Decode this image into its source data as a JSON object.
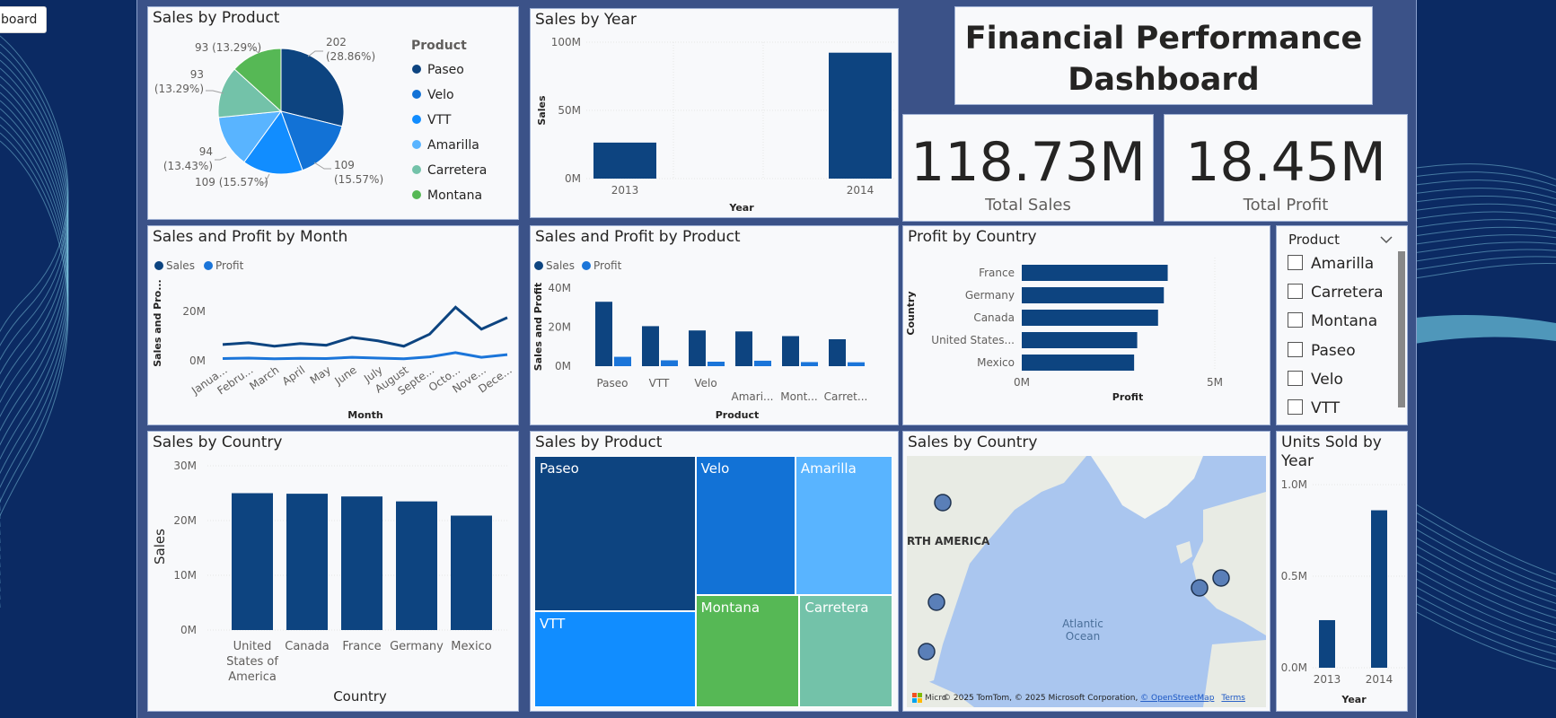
{
  "nav": {
    "back_label": "board"
  },
  "dashboard": {
    "title_line1": "Financial Performance",
    "title_line2": "Dashboard"
  },
  "kpis": {
    "total_sales": {
      "value": "118.73M",
      "label": "Total  Sales"
    },
    "total_profit": {
      "value": "18.45M",
      "label": "Total Profit"
    }
  },
  "colors": {
    "paseo": "#0d4480",
    "velo": "#1272d6",
    "vtt": "#118dff",
    "amarilla": "#59b4ff",
    "carretera": "#73c2a9",
    "montana": "#56b855",
    "bar": "#0d4480",
    "profit": "#1b75d9"
  },
  "slicer": {
    "title": "Product",
    "items": [
      "Amarilla",
      "Carretera",
      "Montana",
      "Paseo",
      "Velo",
      "VTT"
    ]
  },
  "chart_data": [
    {
      "id": "sales_by_product_pie",
      "type": "pie",
      "title": "Sales by Product",
      "legend_title": "Product",
      "legend_position": "right",
      "slices": [
        {
          "name": "Paseo",
          "value": 202,
          "pct": "28.86%"
        },
        {
          "name": "Velo",
          "value": 109,
          "pct": "15.57%"
        },
        {
          "name": "VTT",
          "value": 109,
          "pct": "15.57%"
        },
        {
          "name": "Amarilla",
          "value": 94,
          "pct": "13.43%"
        },
        {
          "name": "Carretera",
          "value": 93,
          "pct": "13.29%"
        },
        {
          "name": "Montana",
          "value": 93,
          "pct": "13.29%"
        }
      ],
      "data_labels": {
        "paseo": [
          "202",
          "(28.86%)"
        ],
        "velo": [
          "109",
          "(15.57%)"
        ],
        "vtt": "109 (15.57%)",
        "amarilla": [
          "94",
          "(13.43%)"
        ],
        "carretera": [
          "93",
          "(13.29%)"
        ],
        "montana": "93 (13.29%)"
      }
    },
    {
      "id": "sales_by_year",
      "type": "bar",
      "title": "Sales by Year",
      "categories": [
        "2013",
        "2014"
      ],
      "values": [
        26.4,
        92.3
      ],
      "xlabel": "Year",
      "ylabel": "Sales",
      "ylim": [
        0,
        100
      ],
      "yticks": [
        "0M",
        "50M",
        "100M"
      ],
      "grid": true
    },
    {
      "id": "sales_profit_by_month",
      "type": "line",
      "title": "Sales and Profit by Month",
      "categories": [
        "Janua...",
        "Febru...",
        "March",
        "April",
        "May",
        "June",
        "July",
        "August",
        "Septe...",
        "Octo...",
        "Nove...",
        "Dece..."
      ],
      "series": [
        {
          "name": "Sales",
          "values": [
            6.6,
            7.3,
            5.9,
            7.0,
            6.3,
            9.5,
            8.1,
            5.9,
            10.8,
            21.7,
            12.8,
            17.5
          ]
        },
        {
          "name": "Profit",
          "values": [
            0.9,
            1.1,
            0.8,
            1.0,
            0.9,
            1.4,
            1.1,
            0.8,
            1.6,
            3.3,
            1.4,
            2.5
          ]
        }
      ],
      "xlabel": "Month",
      "ylabel": "Sales and Pro...",
      "ylim": [
        0,
        25
      ],
      "yticks": [
        "0M",
        "20M"
      ]
    },
    {
      "id": "sales_profit_by_product",
      "type": "bar",
      "title": "Sales and Profit by Product",
      "categories": [
        "Paseo",
        "VTT",
        "Velo",
        "Amari...",
        "Mont...",
        "Carret..."
      ],
      "series": [
        {
          "name": "Sales",
          "values": [
            33.0,
            20.5,
            18.3,
            17.8,
            15.4,
            13.8
          ]
        },
        {
          "name": "Profit",
          "values": [
            4.8,
            3.0,
            2.3,
            2.8,
            2.1,
            2.0
          ]
        }
      ],
      "xlabel": "Product",
      "ylabel": "Sales and Profit",
      "ylim": [
        0,
        40
      ],
      "yticks": [
        "0M",
        "20M",
        "40M"
      ]
    },
    {
      "id": "profit_by_country",
      "type": "bar",
      "orientation": "horizontal",
      "title": "Profit by Country",
      "categories": [
        "France",
        "Germany",
        "Canada",
        "United States...",
        "Mexico"
      ],
      "values": [
        3.78,
        3.68,
        3.53,
        2.99,
        2.91
      ],
      "xlabel": "Profit",
      "ylabel": "Country",
      "xlim": [
        0,
        6
      ],
      "xticks": [
        "0M",
        "5M"
      ]
    },
    {
      "id": "sales_by_country",
      "type": "bar",
      "title": "Sales by Country",
      "categories": [
        [
          "United",
          "States of",
          "America"
        ],
        [
          "Canada"
        ],
        [
          "France"
        ],
        [
          "Germany"
        ],
        [
          "Mexico"
        ]
      ],
      "values": [
        25.0,
        24.9,
        24.4,
        23.5,
        20.9
      ],
      "xlabel": "Country",
      "ylabel": "Sales",
      "ylim": [
        0,
        30
      ],
      "yticks": [
        "0M",
        "10M",
        "20M",
        "30M"
      ]
    },
    {
      "id": "sales_by_product_treemap",
      "type": "treemap",
      "title": "Sales by Product",
      "cells": [
        {
          "name": "Paseo",
          "value": 33.0
        },
        {
          "name": "VTT",
          "value": 20.5
        },
        {
          "name": "Velo",
          "value": 18.3
        },
        {
          "name": "Amarilla",
          "value": 17.8
        },
        {
          "name": "Montana",
          "value": 15.4
        },
        {
          "name": "Carretera",
          "value": 13.8
        }
      ]
    },
    {
      "id": "sales_by_country_map",
      "type": "map",
      "title": "Sales by Country",
      "labels": {
        "region": "RTH AMERICA",
        "ocean_line1": "Atlantic",
        "ocean_line2": "Ocean",
        "attribution": "© 2025 TomTom, © 2025 Microsoft Corporation, ",
        "osm_link": "© OpenStreetMap",
        "terms_link": "Terms",
        "brand": "Micro"
      }
    },
    {
      "id": "units_sold_by_year",
      "type": "bar",
      "title": "Units Sold by Year",
      "title_lines": [
        "Units Sold by",
        "Year"
      ],
      "categories": [
        "2013",
        "2014"
      ],
      "values": [
        0.26,
        0.86
      ],
      "xlabel": "Year",
      "ylim": [
        0,
        1.0
      ],
      "yticks": [
        "0.0M",
        "0.5M",
        "1.0M"
      ]
    }
  ]
}
